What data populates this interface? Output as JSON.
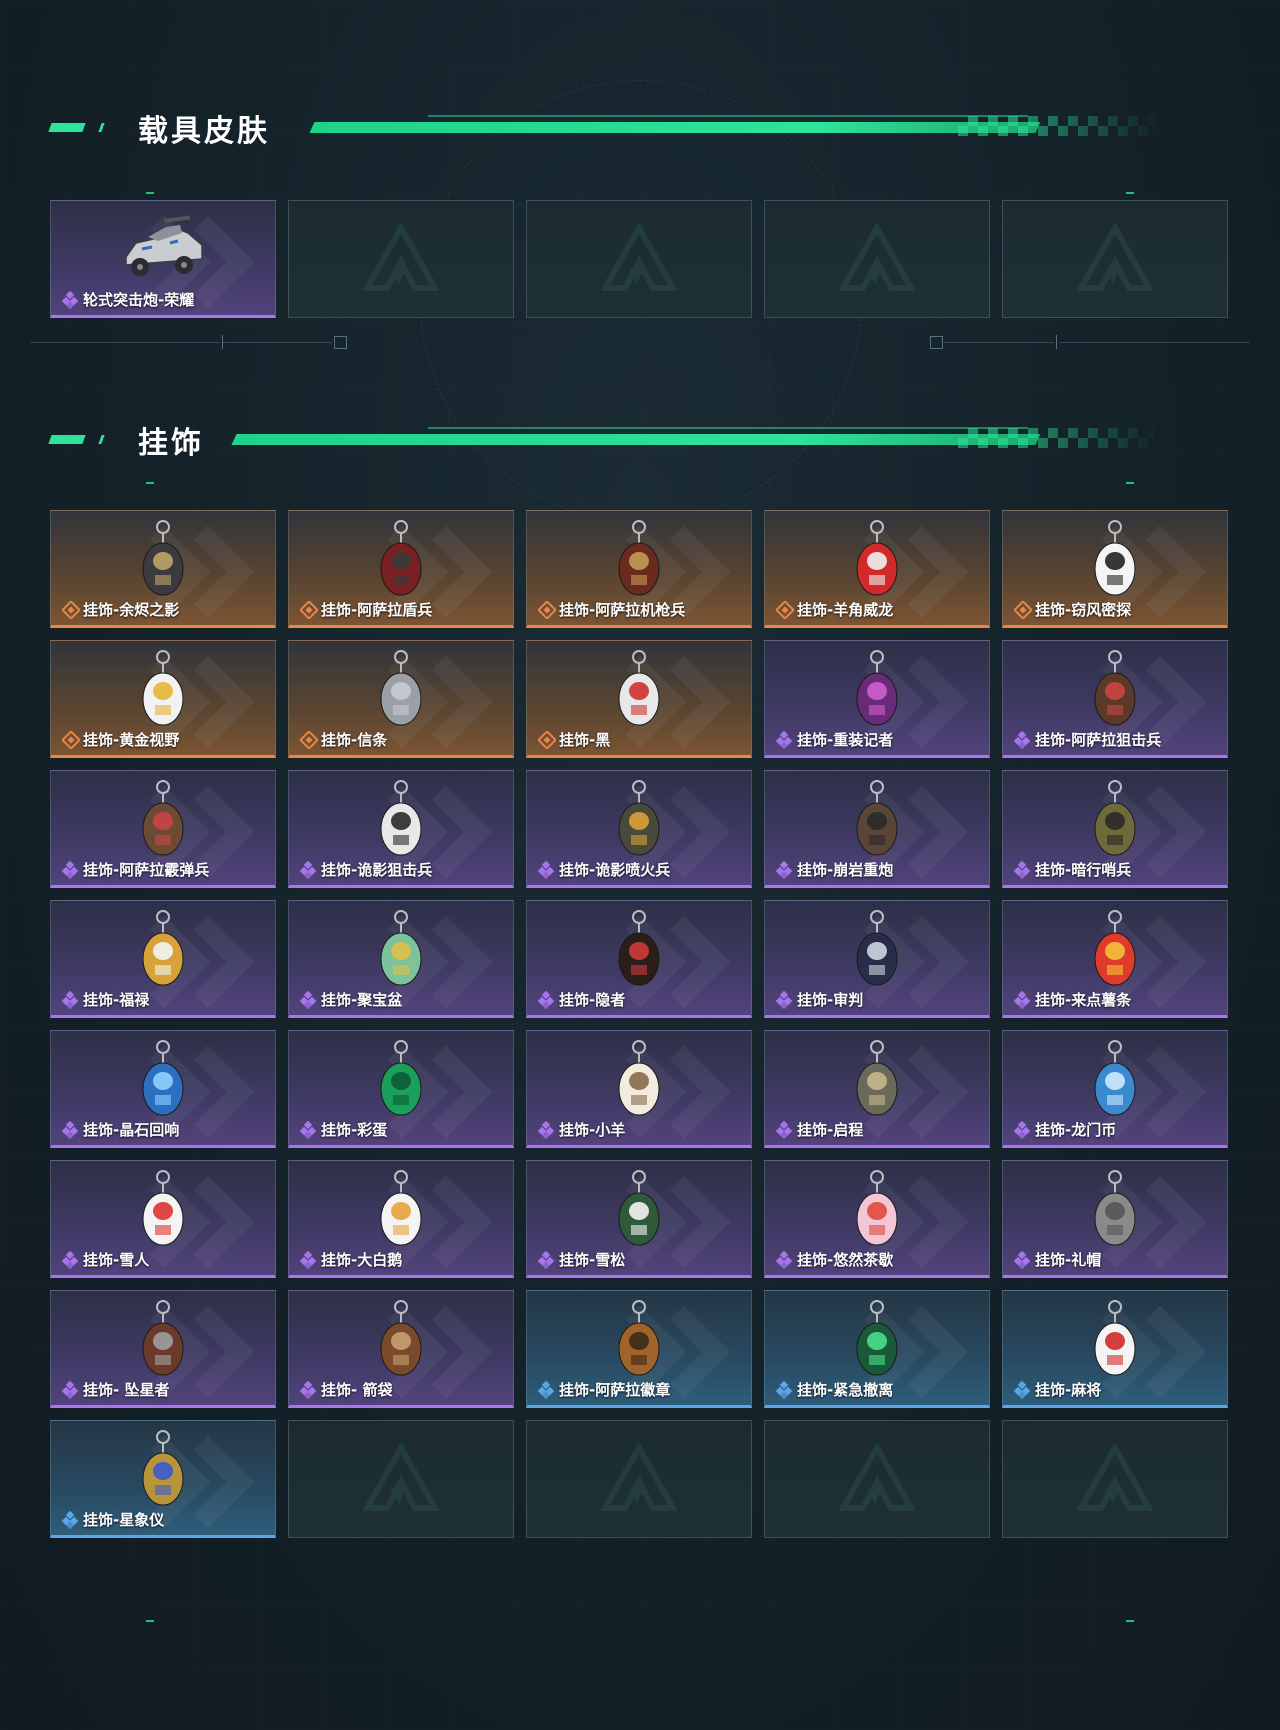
{
  "sections": {
    "vehicle": {
      "title": "载具皮肤"
    },
    "charms": {
      "title": "挂饰"
    }
  },
  "colors": {
    "accent": "#2ee39a",
    "orange": "#e8874a",
    "purple": "#a875ee",
    "blue": "#59a6ea"
  },
  "vehicle_items": [
    {
      "label": "轮式突击炮-荣耀",
      "rarity": "purple",
      "icon": "armored-vehicle-icon"
    },
    {
      "empty": true
    },
    {
      "empty": true
    },
    {
      "empty": true
    },
    {
      "empty": true
    }
  ],
  "charm_items": [
    {
      "label": "挂饰-余烬之影",
      "rarity": "orange",
      "icon": "armored-figure-charm-icon"
    },
    {
      "label": "挂饰-阿萨拉盾兵",
      "rarity": "orange",
      "icon": "shield-soldier-charm-icon"
    },
    {
      "label": "挂饰-阿萨拉机枪兵",
      "rarity": "orange",
      "icon": "machine-gunner-charm-icon"
    },
    {
      "label": "挂饰-羊角威龙",
      "rarity": "orange",
      "icon": "horned-figure-charm-icon"
    },
    {
      "label": "挂饰-窃风密探",
      "rarity": "orange",
      "icon": "white-figure-charm-icon"
    },
    {
      "label": "挂饰-黄金视野",
      "rarity": "orange",
      "icon": "duck-charm-icon"
    },
    {
      "label": "挂饰-信条",
      "rarity": "orange",
      "icon": "keyring-charm-icon"
    },
    {
      "label": "挂饰-黑",
      "rarity": "orange",
      "icon": "tag-charm-icon"
    },
    {
      "label": "挂饰-重装记者",
      "rarity": "purple",
      "icon": "reporter-figure-charm-icon"
    },
    {
      "label": "挂饰-阿萨拉狙击兵",
      "rarity": "purple",
      "icon": "sniper-figure-charm-icon"
    },
    {
      "label": "挂饰-阿萨拉霰弹兵",
      "rarity": "purple",
      "icon": "shotgunner-figure-charm-icon"
    },
    {
      "label": "挂饰-诡影狙击兵",
      "rarity": "purple",
      "icon": "shadow-sniper-charm-icon"
    },
    {
      "label": "挂饰-诡影喷火兵",
      "rarity": "purple",
      "icon": "flamethrower-charm-icon"
    },
    {
      "label": "挂饰-崩岩重炮",
      "rarity": "purple",
      "icon": "heavy-gunner-charm-icon"
    },
    {
      "label": "挂饰-暗行哨兵",
      "rarity": "purple",
      "icon": "sentinel-charm-icon"
    },
    {
      "label": "挂饰-福禄",
      "rarity": "purple",
      "icon": "gourd-charm-icon"
    },
    {
      "label": "挂饰-聚宝盆",
      "rarity": "purple",
      "icon": "treasure-bowl-charm-icon"
    },
    {
      "label": "挂饰-隐者",
      "rarity": "purple",
      "icon": "hermit-card-charm-icon"
    },
    {
      "label": "挂饰-审判",
      "rarity": "purple",
      "icon": "judgement-card-charm-icon"
    },
    {
      "label": "挂饰-来点薯条",
      "rarity": "purple",
      "icon": "fries-charm-icon"
    },
    {
      "label": "挂饰-晶石回响",
      "rarity": "purple",
      "icon": "crystal-charm-icon"
    },
    {
      "label": "挂饰-彩蛋",
      "rarity": "purple",
      "icon": "green-egg-charm-icon"
    },
    {
      "label": "挂饰-小羊",
      "rarity": "purple",
      "icon": "lamb-charm-icon"
    },
    {
      "label": "挂饰-启程",
      "rarity": "purple",
      "icon": "compass-charm-icon"
    },
    {
      "label": "挂饰-龙门币",
      "rarity": "purple",
      "icon": "coin-charm-icon"
    },
    {
      "label": "挂饰-雪人",
      "rarity": "purple",
      "icon": "snowman-charm-icon"
    },
    {
      "label": "挂饰-大白鹅",
      "rarity": "purple",
      "icon": "goose-charm-icon"
    },
    {
      "label": "挂饰-雪松",
      "rarity": "purple",
      "icon": "pine-tree-charm-icon"
    },
    {
      "label": "挂饰-悠然茶歇",
      "rarity": "purple",
      "icon": "cupcake-charm-icon"
    },
    {
      "label": "挂饰-礼帽",
      "rarity": "purple",
      "icon": "fedora-charm-icon"
    },
    {
      "label": "挂饰- 坠星者",
      "rarity": "purple",
      "icon": "triangle-emblem-charm-icon"
    },
    {
      "label": "挂饰- 箭袋",
      "rarity": "purple",
      "icon": "quiver-charm-icon"
    },
    {
      "label": "挂饰-阿萨拉徽章",
      "rarity": "blue",
      "icon": "badge-charm-icon"
    },
    {
      "label": "挂饰-紧急撤离",
      "rarity": "blue",
      "icon": "evac-sign-charm-icon"
    },
    {
      "label": "挂饰-麻将",
      "rarity": "blue",
      "icon": "mahjong-charm-icon"
    },
    {
      "label": "挂饰-星象仪",
      "rarity": "blue",
      "icon": "astrolabe-charm-icon"
    },
    {
      "empty": true
    },
    {
      "empty": true
    },
    {
      "empty": true
    },
    {
      "empty": true
    }
  ]
}
